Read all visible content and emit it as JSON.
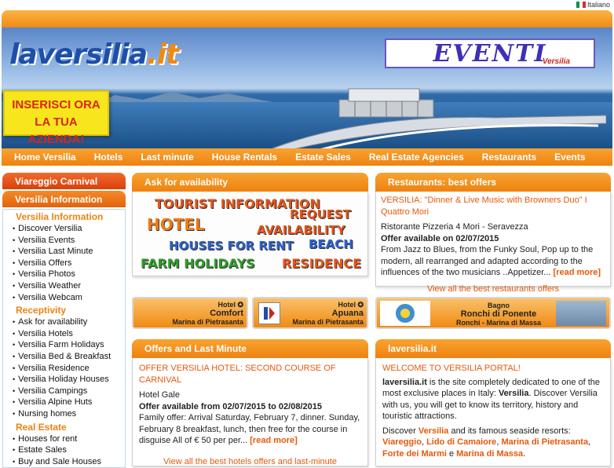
{
  "lang": {
    "label": "Italiano"
  },
  "hero": {
    "logo_main": "laversilia",
    "logo_tld": ".it",
    "eventi_title": "EVENTI",
    "eventi_sub": "Versilia",
    "promo_line1": "INSERISCI ORA",
    "promo_line2": "LA TUA AZIENDA!"
  },
  "nav": [
    "Home Versilia",
    "Hotels",
    "Last minute",
    "House Rentals",
    "Estate Sales",
    "Real Estate Agencies",
    "Restaurants",
    "Events"
  ],
  "sidebar": {
    "carnival": "Viareggio Carnival",
    "info_head": "Versilia Information",
    "sec_info": "Versilia Information",
    "info_items": [
      "Discover Versilia",
      "Versilia Events",
      "Versilia Last Minute",
      "Versilia Offers",
      "Versilia Photos",
      "Versilia Weather",
      "Versilia Webcam"
    ],
    "sec_recept": "Receptivity",
    "recept_items": [
      "Ask for availability",
      "Versilia Hotels",
      "Versilia Farm Holidays",
      "Versilia Bed & Breakfast",
      "Versilia Residence",
      "Versilia Holiday Houses",
      "Versilia Campings",
      "Versilia Alpine Huts",
      "Nursing homes"
    ],
    "sec_real": "Real Estate",
    "real_items": [
      "Houses for rent",
      "Estate Sales",
      "Buy and Sale Houses"
    ]
  },
  "ask": {
    "title": "Ask for availability",
    "w1": "TOURIST INFORMATION",
    "w2": "REQUEST",
    "w3": "HOTEL",
    "w4": "AVAILABILITY",
    "w5": "HOUSES FOR RENT",
    "w6": "BEACH",
    "w7": "FARM HOLIDAYS",
    "w8": "RESIDENCE"
  },
  "restaurants": {
    "title": "Restaurants: best offers",
    "item_title": "VERSILIA: \"Dinner & Live Music with Browners Duo\" I Quattro Mori",
    "venue": "Ristorante Pizzeria 4 Mori - Seravezza",
    "available": "Offer available on 02/07/2015",
    "desc": "From Jazz to Blues, from the Funky Soul, Pop up to the modern, all rearranged and adapted according to the influences of the two musicians ..Appetizer...",
    "read_more": "[read more]",
    "view_all": "View all the best restaurants offers"
  },
  "banners": [
    {
      "line1": "Hotel",
      "line2": "Comfort",
      "line3": "Marina di Pietrasanta"
    },
    {
      "line1": "Hotel",
      "line2": "Apuana",
      "line3": "Marina di Pietrasanta"
    },
    {
      "line1": "Bagno",
      "line2": "Ronchi di Ponente",
      "line3": "Ronchi - Marina di Massa"
    }
  ],
  "offers": {
    "title": "Offers and Last Minute",
    "item_title": "OFFER VERSILIA HOTEL: SECOND COURSE OF CARNIVAL",
    "hotel": "Hotel Gale",
    "available": "Offer available from 02/07/2015 to 02/08/2015",
    "desc": "Family offer: Arrival Saturday, February 7, dinner. Sunday, February 8 breakfast, lunch, then free for the course in disguise All of € 50 per per...",
    "read_more": "[read more]",
    "view_all": "View all the best hotels offers and last-minute"
  },
  "laversilia": {
    "title": "laversilia.it",
    "welcome": "WELCOME TO VERSILIA PORTAL!",
    "p1_a": "laversilia.it",
    "p1_b": " is the site completely dedicated to one of the most exclusive places in Italy: ",
    "p1_c": "Versilia",
    "p1_d": ". Discover Versilia with us, you will get to know its territory, history and touristic attractions.",
    "p2_a": "Discover ",
    "p2_b": "Versilia",
    "p2_c": " and its famous seaside resorts: ",
    "p2_d": "Viareggio",
    "p2_e": ", ",
    "p2_f": "Lido di Camaiore",
    "p2_g": ", ",
    "p2_h": "Marina di Pietrasanta",
    "p2_i": ", ",
    "p2_j": "Forte dei Marmi",
    "p2_k": " e ",
    "p2_l": "Marina di Massa",
    "p2_m": "."
  },
  "colors": {
    "accent": "#ef8210",
    "link": "#e6580c",
    "blue": "#1e4fa8"
  }
}
